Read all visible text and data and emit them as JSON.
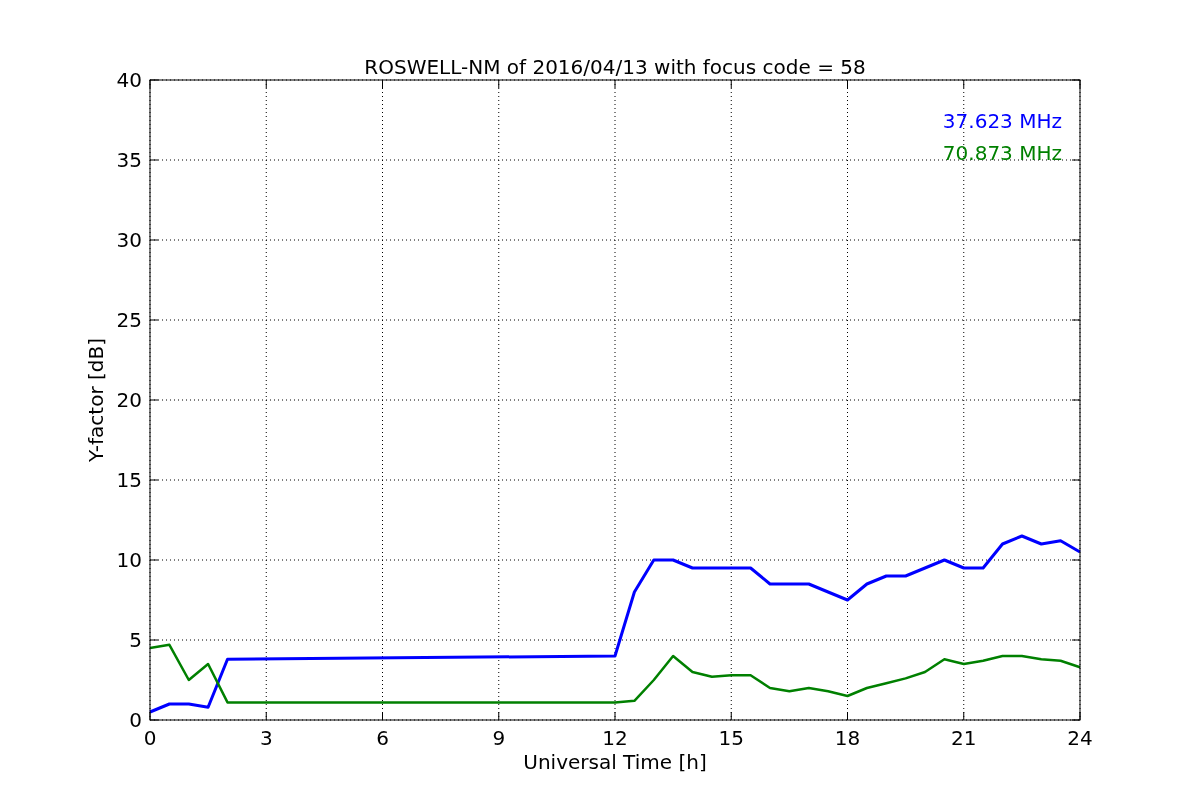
{
  "chart_data": {
    "type": "line",
    "title": "ROSWELL-NM of 2016/04/13 with focus code = 58",
    "xlabel": "Universal Time [h]",
    "ylabel": "Y-factor [dB]",
    "x": [
      0,
      0.5,
      1,
      1.5,
      2,
      12,
      12.5,
      13,
      13.5,
      14,
      14.5,
      15,
      15.5,
      16,
      16.5,
      17,
      17.5,
      18,
      18.5,
      19,
      19.5,
      20,
      20.5,
      21,
      21.5,
      22,
      22.5,
      23,
      23.5,
      24
    ],
    "series": [
      {
        "name": "37.623 MHz",
        "color": "#0000ff",
        "values": [
          0.5,
          1.0,
          1.0,
          0.8,
          3.8,
          4.0,
          8.0,
          10.0,
          10.0,
          9.5,
          9.5,
          9.5,
          9.5,
          8.5,
          8.5,
          8.5,
          8.0,
          7.5,
          8.5,
          9.0,
          9.0,
          9.5,
          10.0,
          9.5,
          9.5,
          11.0,
          11.5,
          11.0,
          11.2,
          10.5
        ]
      },
      {
        "name": "70.873 MHz",
        "color": "#008000",
        "values": [
          4.5,
          4.7,
          2.5,
          3.5,
          1.1,
          1.1,
          1.2,
          2.5,
          4.0,
          3.0,
          2.7,
          2.8,
          2.8,
          2.0,
          1.8,
          2.0,
          1.8,
          1.5,
          2.0,
          2.3,
          2.6,
          3.0,
          3.8,
          3.5,
          3.7,
          4.0,
          4.0,
          3.8,
          3.7,
          3.3
        ]
      }
    ],
    "grid": true,
    "xlim": [
      0,
      24
    ],
    "ylim": [
      0,
      40
    ],
    "xticks": [
      0,
      3,
      6,
      9,
      12,
      15,
      18,
      21,
      24
    ],
    "yticks": [
      0,
      5,
      10,
      15,
      20,
      25,
      30,
      35,
      40
    ]
  }
}
